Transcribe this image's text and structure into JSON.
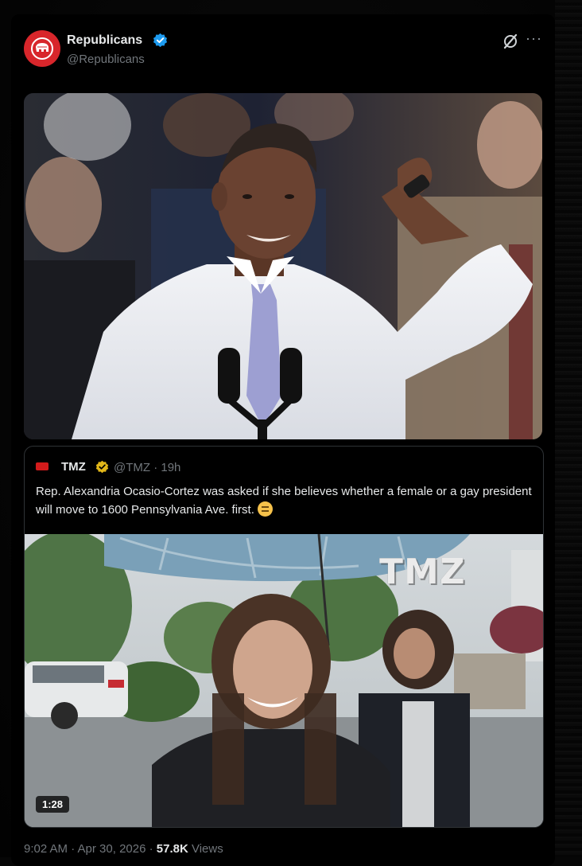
{
  "post": {
    "author_name": "Republicans",
    "author_handle": "@Republicans",
    "avatar_icon": "gop-elephant-icon",
    "verified_icon": "verified-badge-icon",
    "grok_icon": "grok-icon",
    "more_icon": "more-options-icon",
    "more_label": "···",
    "image_alt": "Man in white shirt and lavender tie scratching head at microphones",
    "footer_time": "9:02 AM · Apr 30, 2026 · ",
    "footer_views": "57.8K",
    "footer_views_label": " Views"
  },
  "quote": {
    "author_name": "TMZ",
    "badge_icon": "gold-verified-icon",
    "meta": "@TMZ · 19h",
    "text": "Rep. Alexandria Ocasio-Cortez was asked if she believes whether a female or a gay president will move to 1600 Pennsylvania Ave. first.",
    "emoji_icon": "thinking-face-emoji",
    "watermark": "TMZ",
    "video_duration": "1:28"
  },
  "colors": {
    "background": "#000000",
    "text_primary": "#e7e9ea",
    "text_secondary": "#71767b",
    "verified_blue": "#1d9bf0",
    "verified_gold": "#e2b719",
    "brand_red": "#d8262b"
  }
}
